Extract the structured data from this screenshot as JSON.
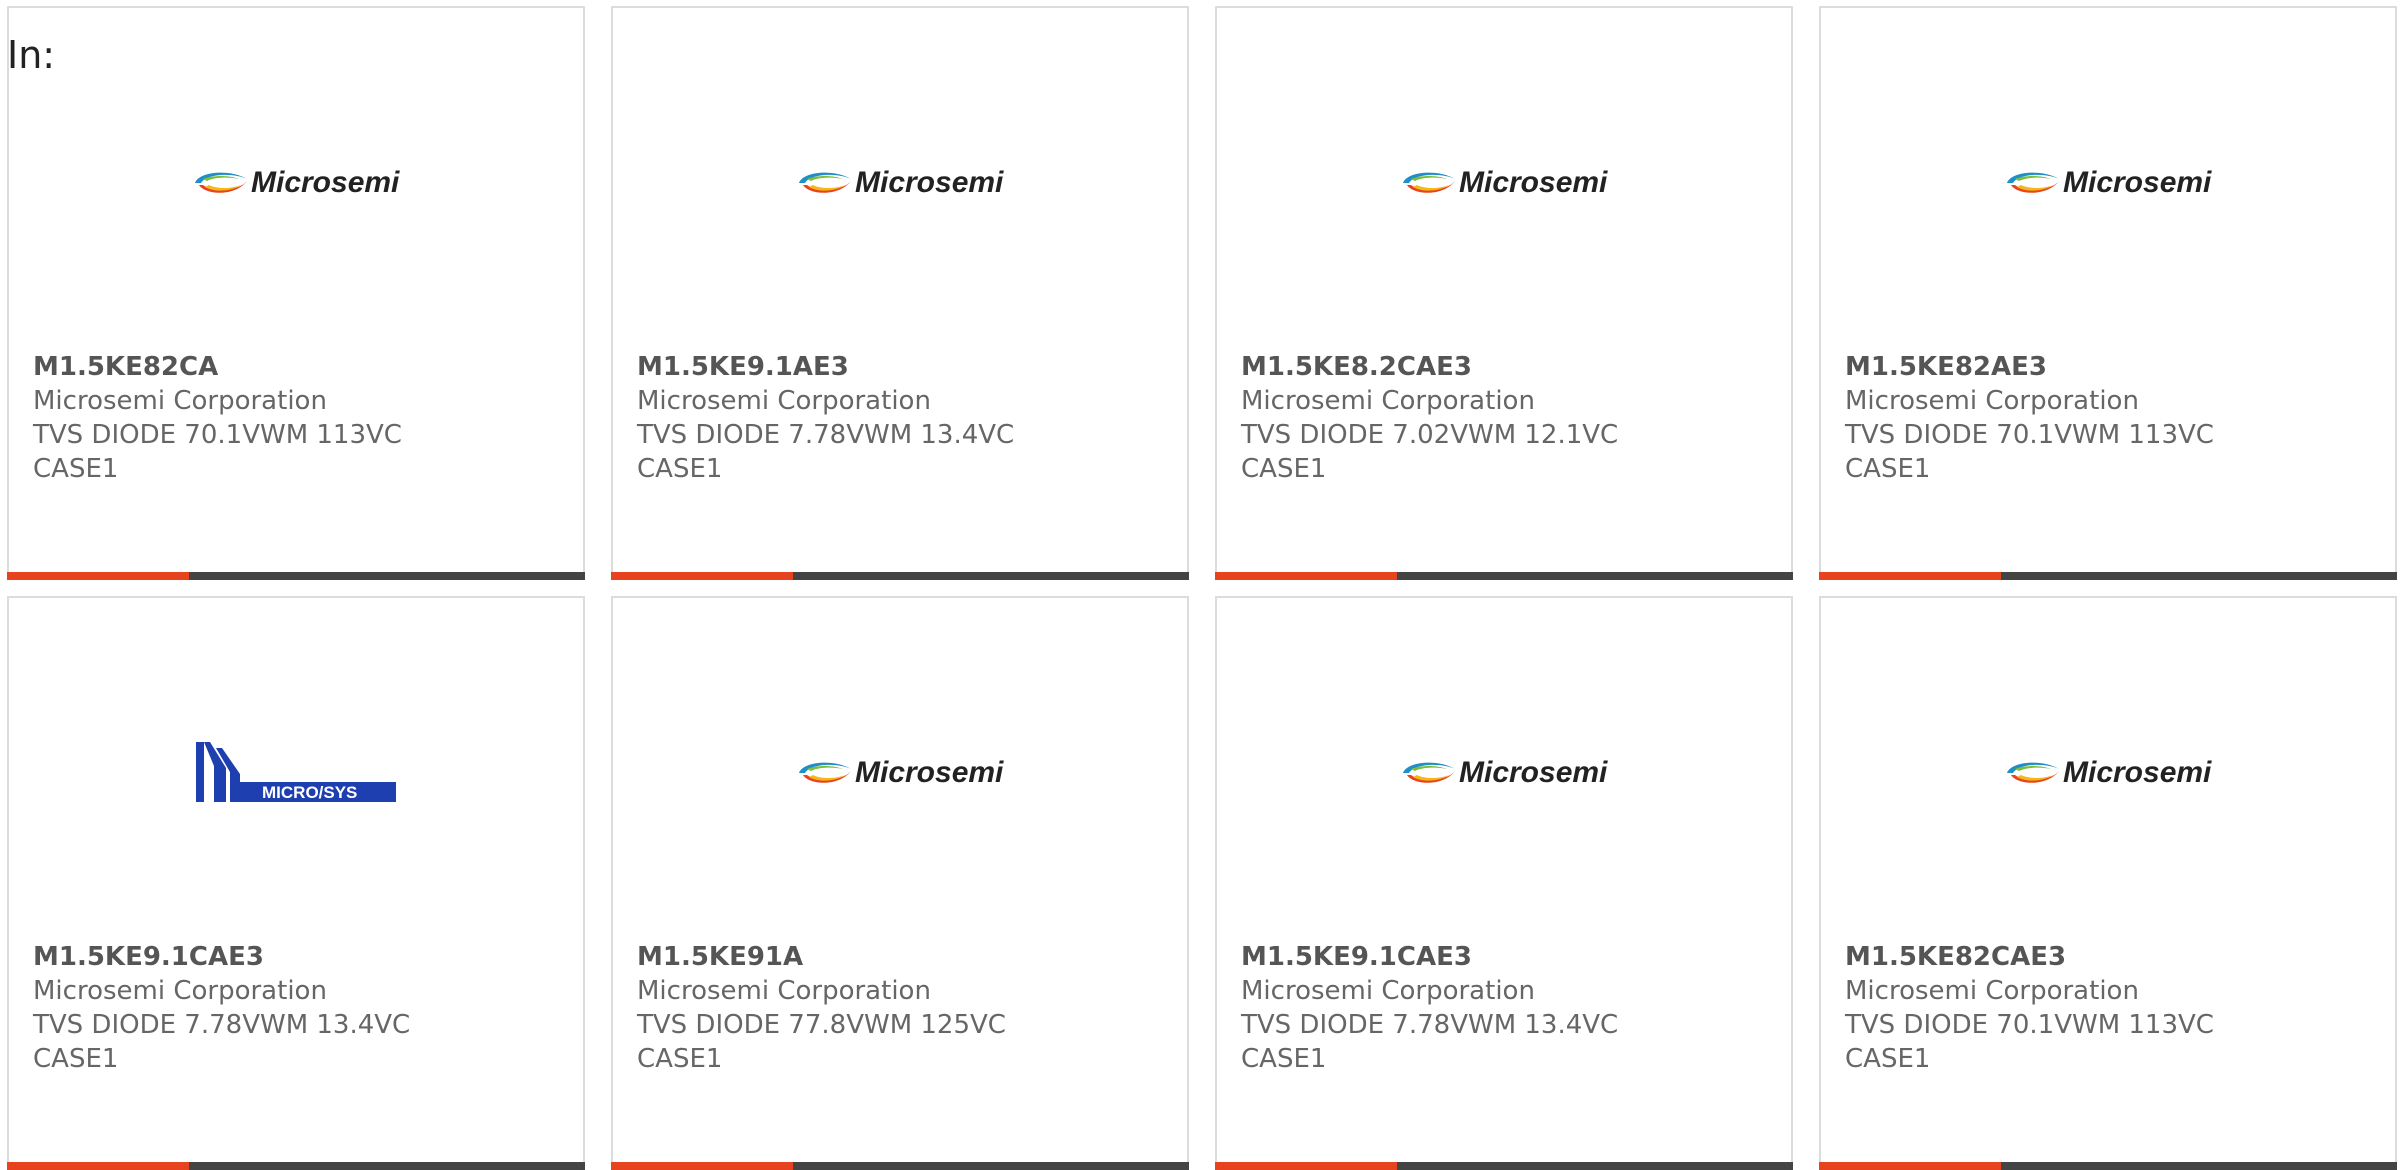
{
  "heading": "In:",
  "colors": {
    "accent": "#e8431f",
    "bar": "#444444",
    "border": "#dcdcdc"
  },
  "logos": {
    "microsemi": {
      "text": "Microsemi",
      "icon": "microsemi-swirl-logo"
    },
    "microsys": {
      "text": "MICRO/SYS",
      "icon": "microsys-logo"
    }
  },
  "products": [
    {
      "part": "M1.5KE82CA",
      "maker": "Microsemi Corporation",
      "desc": "TVS DIODE 70.1VWM 113VC",
      "pkg": "CASE1",
      "logo": "microsemi"
    },
    {
      "part": "M1.5KE9.1AE3",
      "maker": "Microsemi Corporation",
      "desc": "TVS DIODE 7.78VWM 13.4VC",
      "pkg": "CASE1",
      "logo": "microsemi"
    },
    {
      "part": "M1.5KE8.2CAE3",
      "maker": "Microsemi Corporation",
      "desc": "TVS DIODE 7.02VWM 12.1VC",
      "pkg": "CASE1",
      "logo": "microsemi"
    },
    {
      "part": "M1.5KE82AE3",
      "maker": "Microsemi Corporation",
      "desc": "TVS DIODE 70.1VWM 113VC",
      "pkg": "CASE1",
      "logo": "microsemi"
    },
    {
      "part": "M1.5KE9.1CAE3",
      "maker": "Microsemi Corporation",
      "desc": "TVS DIODE 7.78VWM 13.4VC",
      "pkg": "CASE1",
      "logo": "microsys"
    },
    {
      "part": "M1.5KE91A",
      "maker": "Microsemi Corporation",
      "desc": "TVS DIODE 77.8VWM 125VC",
      "pkg": "CASE1",
      "logo": "microsemi"
    },
    {
      "part": "M1.5KE9.1CAE3",
      "maker": "Microsemi Corporation",
      "desc": "TVS DIODE 7.78VWM 13.4VC",
      "pkg": "CASE1",
      "logo": "microsemi"
    },
    {
      "part": "M1.5KE82CAE3",
      "maker": "Microsemi Corporation",
      "desc": "TVS DIODE 70.1VWM 113VC",
      "pkg": "CASE1",
      "logo": "microsemi"
    }
  ]
}
